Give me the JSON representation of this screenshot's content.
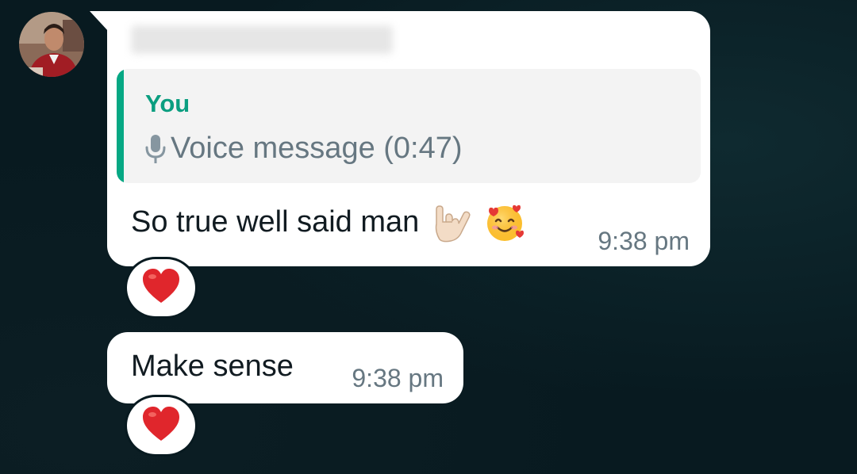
{
  "conversation": {
    "messages": [
      {
        "sender": "",
        "quote": {
          "author": "You",
          "preview": "Voice message (0:47)",
          "icon": "microphone-icon"
        },
        "text": "So true well said man",
        "emojis": [
          "love-you-gesture-emoji",
          "smiling-face-with-hearts-emoji"
        ],
        "time": "9:38 pm",
        "reaction": "red-heart-emoji"
      },
      {
        "text": "Make sense",
        "time": "9:38 pm",
        "reaction": "red-heart-emoji"
      }
    ]
  },
  "colors": {
    "background": "#081a20",
    "bubble": "#ffffff",
    "quote_bg": "#f3f3f3",
    "quote_accent": "#06a884",
    "quote_author": "#0b9e80",
    "meta_text": "#667781",
    "body_text": "#111b21",
    "heart": "#e0262c"
  }
}
